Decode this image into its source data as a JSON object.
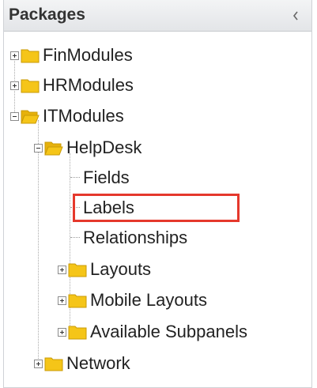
{
  "panel": {
    "title": "Packages",
    "collapse_icon": "chevron-left-icon"
  },
  "tree": {
    "finmodules": "FinModules",
    "hrmodules": "HRModules",
    "itmodules": "ITModules",
    "helpdesk": "HelpDesk",
    "fields": "Fields",
    "labels": "Labels",
    "relationships": "Relationships",
    "layouts": "Layouts",
    "mobile_layouts": "Mobile Layouts",
    "available_subpanels": "Available Subpanels",
    "network": "Network"
  },
  "colors": {
    "folder": "#f5c518",
    "highlight": "#e5382c"
  }
}
